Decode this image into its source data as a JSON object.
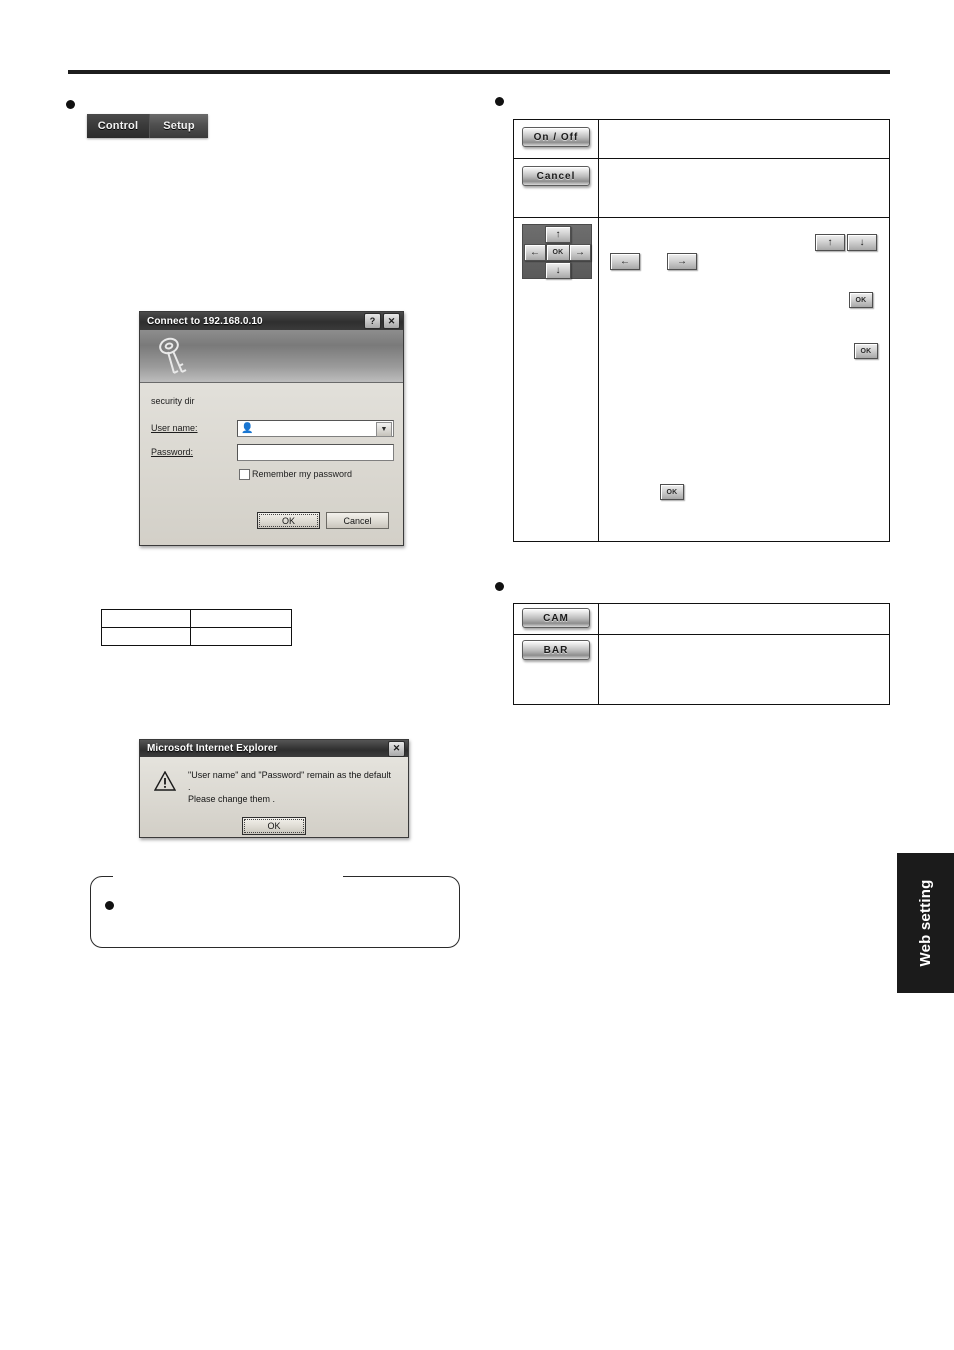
{
  "page": {
    "side_tab_label": "Web setting"
  },
  "nav_tabs": {
    "control_label": "Control",
    "setup_label": "Setup"
  },
  "connect_dialog": {
    "title": "Connect to 192.168.0.10",
    "help_button": "?",
    "close_button": "✕",
    "realm": "security dir",
    "username_label": "User name:",
    "username_value": "",
    "password_label": "Password:",
    "password_value": "",
    "remember_label": "Remember my password",
    "combo_arrow": "▼",
    "user_glyph": "👤",
    "ok_label": "OK",
    "cancel_label": "Cancel"
  },
  "ie_alert": {
    "title": "Microsoft Internet Explorer",
    "close_button": "✕",
    "message_line1": "\"User name\" and \"Password\" remain as the default .",
    "message_line2": "Please change them .",
    "ok_label": "OK"
  },
  "left_table": {
    "rows": [
      [
        "",
        ""
      ],
      [
        "",
        ""
      ]
    ]
  },
  "button_table_1": {
    "rows": [
      {
        "button": "On / Off",
        "description": ""
      },
      {
        "button": "Cancel",
        "description": ""
      },
      {
        "button": "dpad",
        "description": ""
      }
    ],
    "dpad": {
      "up": "↑",
      "down": "↓",
      "left": "←",
      "right": "→",
      "ok": "OK"
    },
    "inline_icons": {
      "left_arrow": "←",
      "right_arrow": "→",
      "up_arrow": "↑",
      "down_arrow": "↓",
      "ok_1": "OK",
      "ok_2": "OK",
      "ok_3": "OK"
    }
  },
  "button_table_2": {
    "rows": [
      {
        "button": "CAM",
        "description": ""
      },
      {
        "button": "BAR",
        "description": ""
      }
    ]
  },
  "note_box": {
    "text": ""
  }
}
